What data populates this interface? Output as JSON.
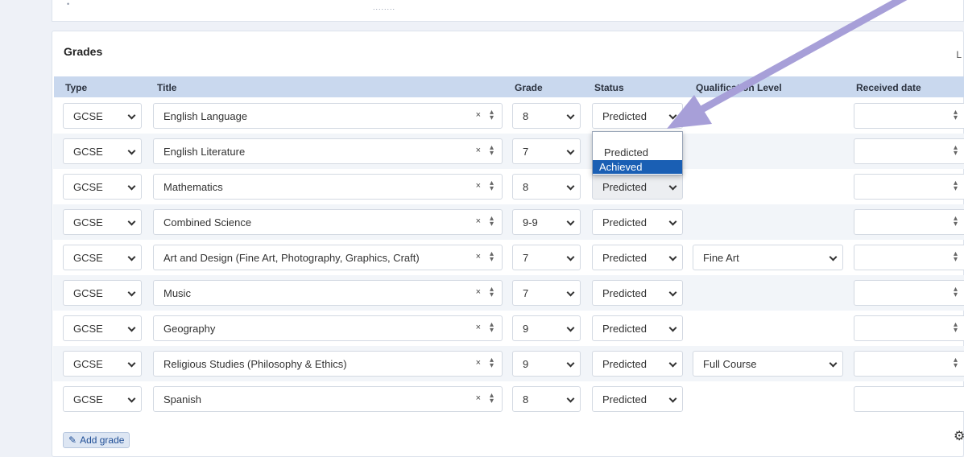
{
  "top_strip": {
    "left_text": "•  ",
    "dots": "........"
  },
  "card": {
    "title": "Grades",
    "right_text": "L"
  },
  "columns": {
    "type": "Type",
    "title": "Title",
    "grade": "Grade",
    "status": "Status",
    "qualification_level": "Qualification Level",
    "received_date": "Received date"
  },
  "rows": [
    {
      "type": "GCSE",
      "title": "English Language",
      "grade": "8",
      "status": "Predicted",
      "qualification": ""
    },
    {
      "type": "GCSE",
      "title": "English Literature",
      "grade": "7",
      "status": "Predicted",
      "qualification": ""
    },
    {
      "type": "GCSE",
      "title": "Mathematics",
      "grade": "8",
      "status": "Predicted",
      "qualification": ""
    },
    {
      "type": "GCSE",
      "title": "Combined Science",
      "grade": "9-9",
      "status": "Predicted",
      "qualification": ""
    },
    {
      "type": "GCSE",
      "title": "Art and Design (Fine Art, Photography, Graphics, Craft)",
      "grade": "7",
      "status": "Predicted",
      "qualification": "Fine Art"
    },
    {
      "type": "GCSE",
      "title": "Music",
      "grade": "7",
      "status": "Predicted",
      "qualification": ""
    },
    {
      "type": "GCSE",
      "title": "Geography",
      "grade": "9",
      "status": "Predicted",
      "qualification": ""
    },
    {
      "type": "GCSE",
      "title": "Religious Studies (Philosophy & Ethics)",
      "grade": "9",
      "status": "Predicted",
      "qualification": "Full Course"
    },
    {
      "type": "GCSE",
      "title": "Spanish",
      "grade": "8",
      "status": "Predicted",
      "qualification": ""
    }
  ],
  "status_dropdown": {
    "options": [
      "Predicted",
      "Achieved"
    ],
    "highlighted": "Achieved"
  },
  "glyphs": {
    "clear": "×",
    "up": "▴",
    "down": "▾",
    "edit": "✎",
    "corner": "⚙"
  },
  "add_grade_label": "Add grade",
  "colors": {
    "header_bg": "#c9d8ee",
    "highlight": "#1a5fb4",
    "arrow": "#a79fd8"
  }
}
